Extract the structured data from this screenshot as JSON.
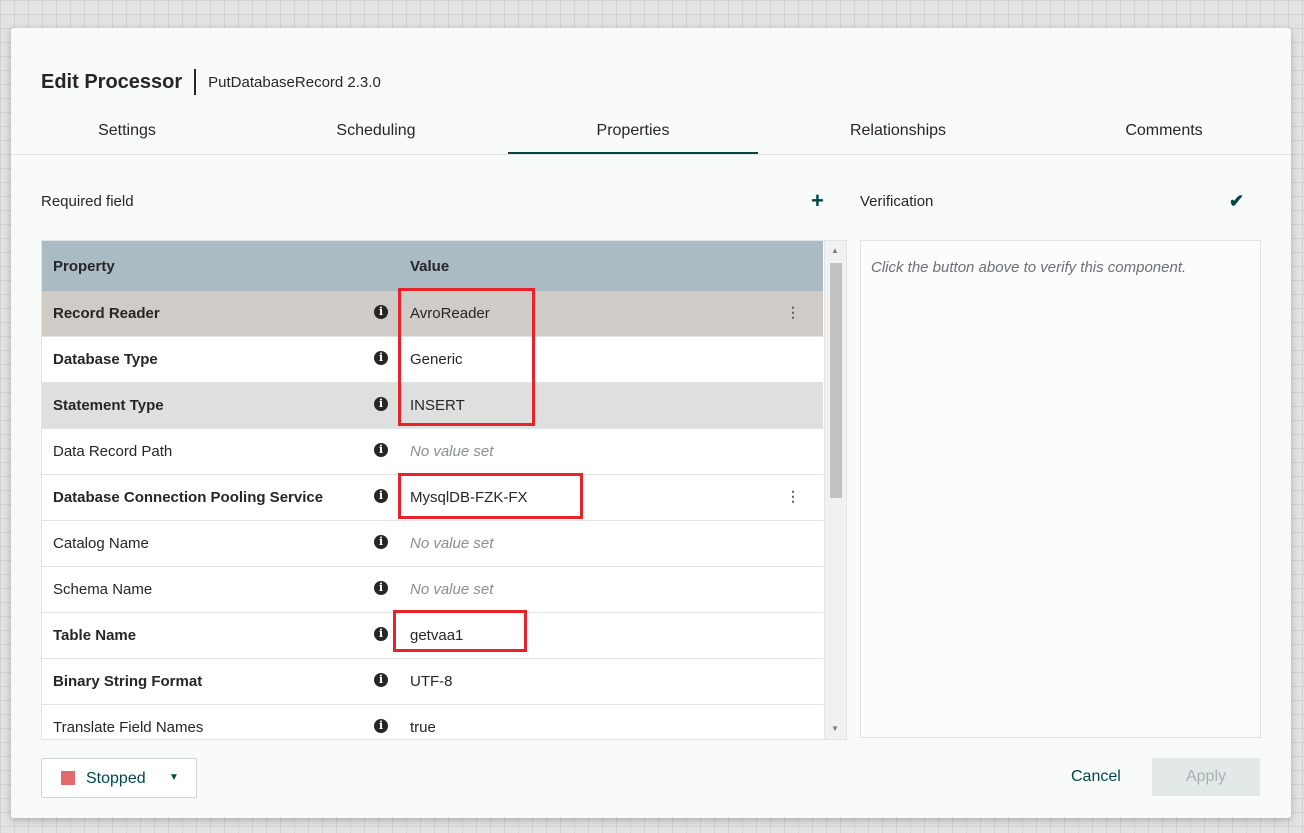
{
  "dialog": {
    "title": "Edit Processor",
    "subtitle": "PutDatabaseRecord 2.3.0"
  },
  "tabs": [
    {
      "label": "Settings"
    },
    {
      "label": "Scheduling"
    },
    {
      "label": "Properties",
      "active": true
    },
    {
      "label": "Relationships"
    },
    {
      "label": "Comments"
    }
  ],
  "properties_panel": {
    "required_label": "Required field",
    "add_icon": "plus-icon",
    "headers": {
      "property": "Property",
      "value": "Value"
    },
    "rows": [
      {
        "name": "Record Reader",
        "value": "AvroReader",
        "required": true
      },
      {
        "name": "Database Type",
        "value": "Generic",
        "required": true
      },
      {
        "name": "Statement Type",
        "value": "INSERT",
        "required": true
      },
      {
        "name": "Data Record Path",
        "value": "No value set",
        "required": false
      },
      {
        "name": "Database Connection Pooling Service",
        "value": "MysqlDB-FZK-FX",
        "required": true
      },
      {
        "name": "Catalog Name",
        "value": "No value set",
        "required": false
      },
      {
        "name": "Schema Name",
        "value": "No value set",
        "required": false
      },
      {
        "name": "Table Name",
        "value": "getvaa1",
        "required": true
      },
      {
        "name": "Binary String Format",
        "value": "UTF-8",
        "required": true
      },
      {
        "name": "Translate Field Names",
        "value": "true",
        "required": false
      }
    ]
  },
  "verification": {
    "title": "Verification",
    "message": "Click the button above to verify this component.",
    "icon": "checkmark-icon"
  },
  "footer": {
    "status": "Stopped",
    "cancel_label": "Cancel",
    "apply_label": "Apply"
  },
  "colors": {
    "accent": "#004849",
    "highlight_box": "#e8232a",
    "stopped": "#e4696e"
  }
}
